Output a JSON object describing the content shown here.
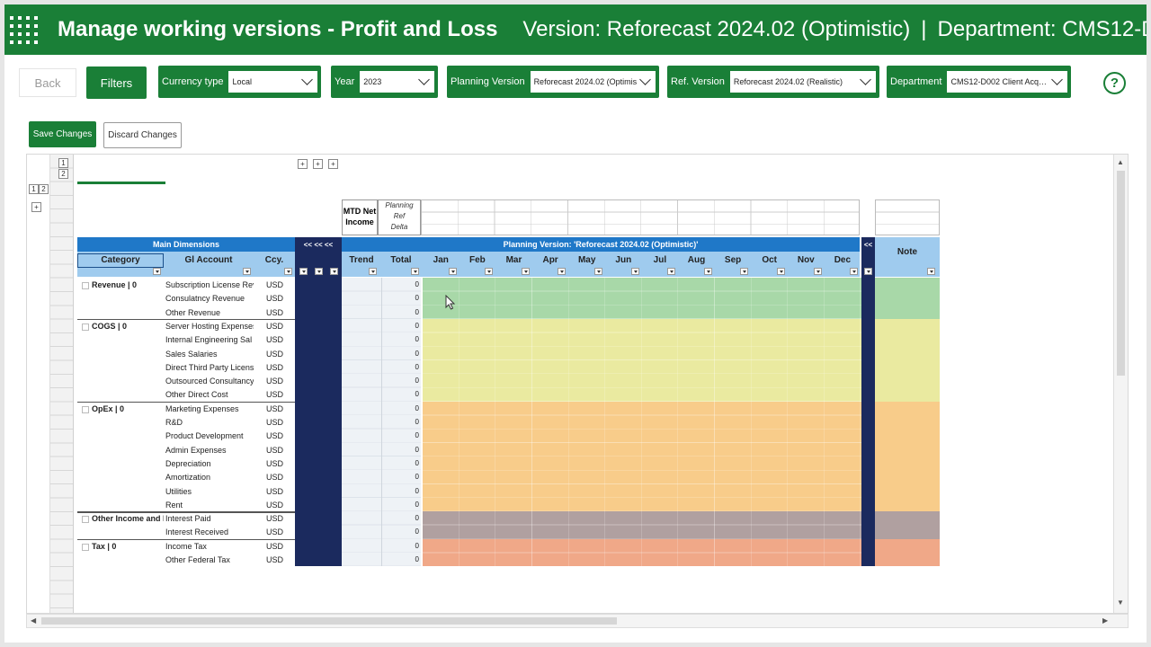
{
  "header": {
    "title": "Manage working versions - Profit and Loss",
    "version_text": "Version: Reforecast 2024.02 (Optimistic)",
    "department_text": "Department: CMS12-D…"
  },
  "toolbar": {
    "back_label": "Back",
    "filters_label": "Filters",
    "currency_label": "Currency type",
    "currency_value": "Local",
    "year_label": "Year",
    "year_value": "2023",
    "planning_label": "Planning Version",
    "planning_value": "Reforecast 2024.02 (Optimis…",
    "ref_label": "Ref. Version",
    "ref_value": "Reforecast 2024.02 (Realistic)",
    "department_label": "Department",
    "department_value": "CMS12-D002 Client Acq…",
    "help_label": "?"
  },
  "actions": {
    "save_label": "Save Changes",
    "discard_label": "Discard Changes"
  },
  "sheet": {
    "outline_levels": [
      "1",
      "2"
    ],
    "mtd_label": "MTD Net Income",
    "mtd_rows": [
      "Planning",
      "Ref",
      "Delta"
    ],
    "collapse_arrows": "<< << <<",
    "main_dim_title": "Main Dimensions",
    "dim_columns": [
      "Category",
      "Gl Account",
      "Ccy."
    ],
    "planning_title": "Planning Version: 'Reforecast 2024.02 (Optimistic)'",
    "trend_label": "Trend",
    "total_label": "Total",
    "months": [
      "Jan",
      "Feb",
      "Mar",
      "Apr",
      "May",
      "Jun",
      "Jul",
      "Aug",
      "Sep",
      "Oct",
      "Nov",
      "Dec"
    ],
    "note_label": "Note",
    "right_collapse": "<<",
    "categories": [
      "Revenue | 0",
      "COGS | 0",
      "OpEx | 0",
      "Other Income and E",
      "Tax | 0"
    ],
    "accounts": [
      "Subscription License Rev",
      "Consulatncy Revenue",
      "Other Revenue",
      "Server Hosting Expenses",
      "Internal Engineering Sal",
      "Sales Salaries",
      "Direct Third Party Licens",
      "Outsourced Consultancy",
      "Other Direct Cost",
      "Marketing Expenses",
      "R&D",
      "Product Development",
      "Admin Expenses",
      "Depreciation",
      "Amortization",
      "Utilities",
      "Rent",
      "Interest Paid",
      "Interest Received",
      "Income Tax",
      "Other Federal Tax"
    ],
    "currency": "USD",
    "total_value": "0",
    "band_colors": {
      "revenue": "#a8d8a8",
      "cogs": "#eaeaa0",
      "opex": "#f8cc8a",
      "other": "#b0a0a0",
      "tax": "#f0a888"
    }
  }
}
